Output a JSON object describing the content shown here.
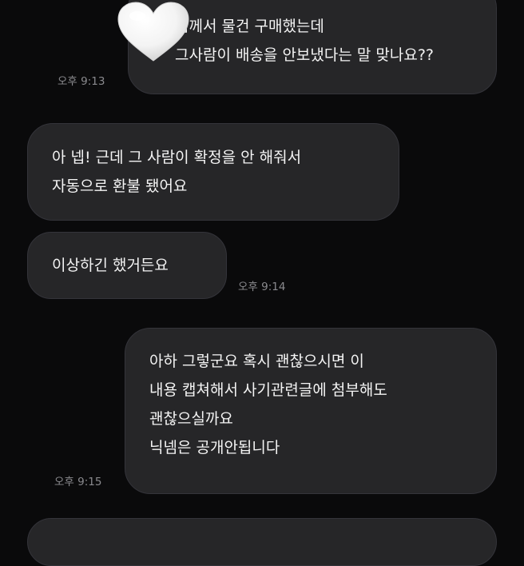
{
  "messages": [
    {
      "side": "sent",
      "lines": [
        "님께서 물건 구매했는데",
        "그사람이 배송을 안보냈다는 말 맞나요??"
      ],
      "time": "오후 9:13"
    },
    {
      "side": "received",
      "lines": [
        "아 넵! 근데 그 사람이 확정을 안 해줘서",
        "자동으로 환불 됐어요"
      ],
      "time": ""
    },
    {
      "side": "received",
      "lines": [
        "이상하긴 했거든요"
      ],
      "time": "오후 9:14"
    },
    {
      "side": "sent",
      "lines": [
        "아하 그렇군요 혹시 괜찮으시면 이",
        "내용 캡쳐해서 사기관련글에 첨부해도",
        "괜찮으실까요",
        "닉넴은 공개안됩니다"
      ],
      "time": "오후 9:15"
    }
  ],
  "colors": {
    "background": "#0a0a0b",
    "bubble": "#262628",
    "bubble_border": "#34343a",
    "timestamp": "#8a8a8e",
    "text": "#f4f4f4"
  },
  "icons": {
    "privacy_cover": "white-heart-sticker-icon"
  }
}
